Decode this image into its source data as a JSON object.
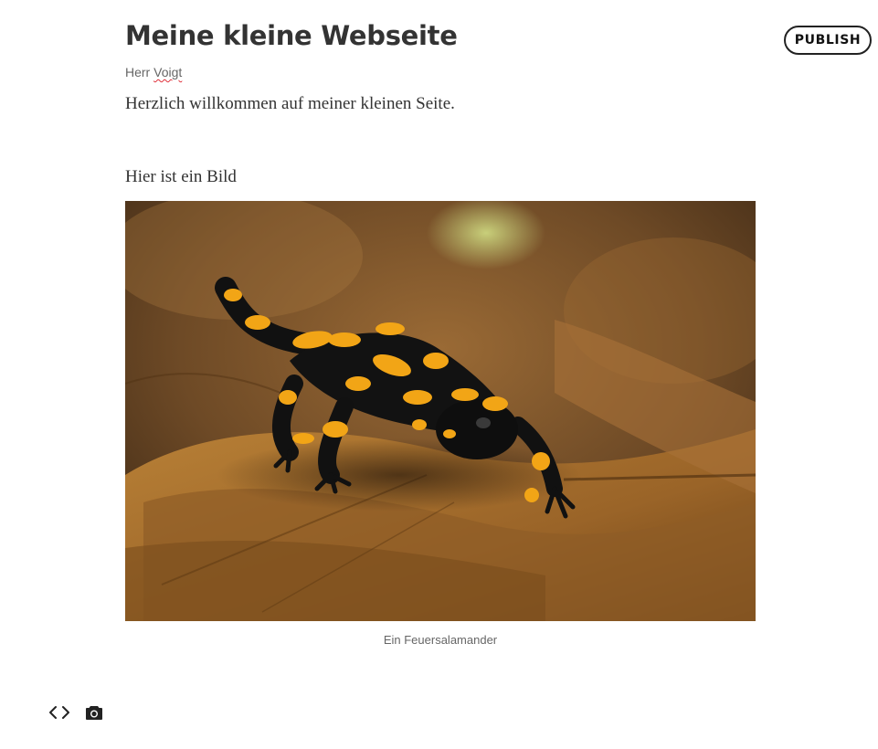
{
  "header": {
    "title": "Meine kleine Webseite",
    "publish_label": "PUBLISH"
  },
  "author": {
    "first": "Herr",
    "last": "Voigt"
  },
  "content": {
    "paragraph_1": "Herzlich willkommen auf meiner kleinen Seite.",
    "paragraph_2": "Hier ist ein Bild",
    "image_caption": "Ein Feuersalamander"
  },
  "toolbar": {
    "code_icon": "code-brackets-icon",
    "camera_icon": "camera-icon"
  },
  "colors": {
    "spellcheck_underline": "#e0303a",
    "salamander_black": "#111111",
    "salamander_yellow": "#f2a516",
    "leaf_brown": "#8a5a22"
  }
}
